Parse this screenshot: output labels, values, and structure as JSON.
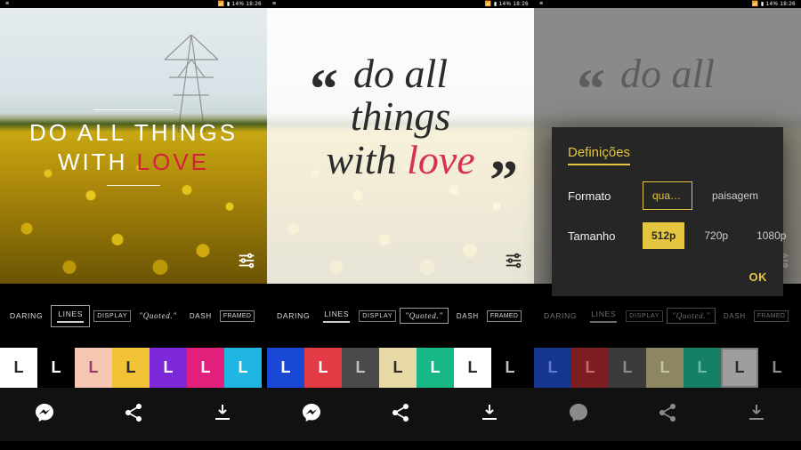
{
  "statusbar": {
    "time": "18:26",
    "battery": "14%"
  },
  "quote": {
    "lines_l1_a": "DO ALL",
    "lines_l1_b": "THINGS",
    "lines_l2_a": "WITH",
    "lines_l2_b": "LOVE",
    "q_l1": "do all",
    "q_l2": "things",
    "q_l3_a": "with ",
    "q_l3_b": "love"
  },
  "styles": [
    {
      "label": "DARING"
    },
    {
      "label": "LINES"
    },
    {
      "label": "DISPLAY"
    },
    {
      "label": "\"Quoted.\""
    },
    {
      "label": "DASH"
    },
    {
      "label": "FRAMED"
    }
  ],
  "styles_selected": {
    "panel1": 1,
    "panel2": 3
  },
  "palette1": [
    {
      "bg": "#ffffff",
      "fg": "#2b2b2b"
    },
    {
      "bg": "#000000",
      "fg": "#ffffff"
    },
    {
      "bg": "#f6c6b2",
      "fg": "#9a3d6a"
    },
    {
      "bg": "#f0c234",
      "fg": "#2b2b2b"
    },
    {
      "bg": "#7d28d9",
      "fg": "#ffffff"
    },
    {
      "bg": "#e21f7a",
      "fg": "#ffffff"
    },
    {
      "bg": "#1fb7e2",
      "fg": "#ffffff"
    }
  ],
  "palette2": [
    {
      "bg": "#1948d6",
      "fg": "#ffffff"
    },
    {
      "bg": "#e23b45",
      "fg": "#ffffff"
    },
    {
      "bg": "#4a4a4a",
      "fg": "#bfbfbf"
    },
    {
      "bg": "#e7d9a5",
      "fg": "#2b2b2b"
    },
    {
      "bg": "#18b886",
      "fg": "#ffffff"
    },
    {
      "bg": "#ffffff",
      "fg": "#2b2b2b"
    },
    {
      "bg": "#000000",
      "fg": "#bfbfbf"
    }
  ],
  "palette3": [
    {
      "bg": "#16368f",
      "fg": "#5f7ac7"
    },
    {
      "bg": "#7c1d22",
      "fg": "#c76a6e"
    },
    {
      "bg": "#3b3b3b",
      "fg": "#8a8a8a"
    },
    {
      "bg": "#8c8760",
      "fg": "#c9c4a0"
    },
    {
      "bg": "#168066",
      "fg": "#6ab8a4"
    },
    {
      "bg": "#9e9e9e",
      "fg": "#2b2b2b"
    },
    {
      "bg": "#000000",
      "fg": "#8a8a8a"
    }
  ],
  "palette1_selected": 0,
  "palette2_selected": 5,
  "palette3_selected": 5,
  "swatch_letter": "L",
  "dialog": {
    "title": "Definições",
    "row1_label": "Formato",
    "row1_opts": [
      "quadr...",
      "paisagem"
    ],
    "row1_sel": 0,
    "row2_label": "Tamanho",
    "row2_opts": [
      "512p",
      "720p",
      "1080p"
    ],
    "row2_sel": 0,
    "ok": "OK"
  }
}
